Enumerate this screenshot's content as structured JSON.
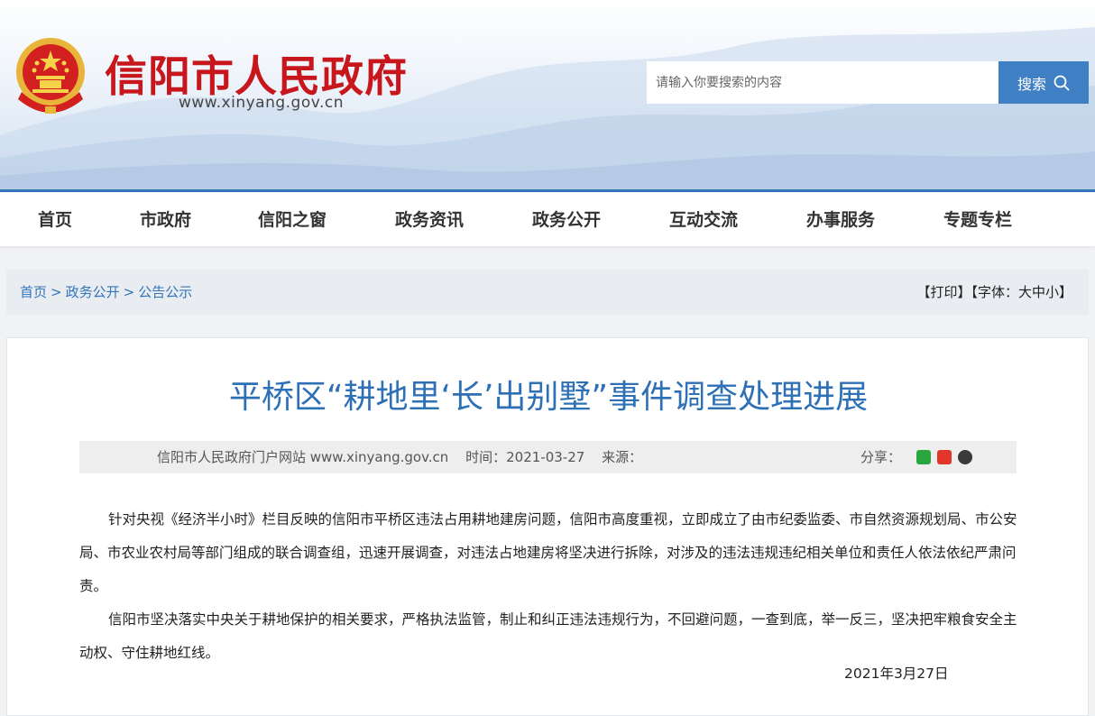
{
  "header": {
    "site_title": "信阳市人民政府",
    "site_url": "www.xinyang.gov.cn",
    "search_placeholder": "请输入你要搜索的内容",
    "search_label": "搜索",
    "emblem_icon": "national-emblem-icon"
  },
  "nav": {
    "items": [
      "首页",
      "市政府",
      "信阳之窗",
      "政务资讯",
      "政务公开",
      "互动交流",
      "办事服务",
      "专题专栏"
    ]
  },
  "breadcrumb": {
    "items": [
      "首页",
      "政务公开",
      "公告公示"
    ],
    "separator": ">",
    "print_label": "【打印】",
    "font_label": "【字体：大中小】"
  },
  "article": {
    "title": "平桥区“耕地里‘长’出别墅”事件调查处理进展",
    "meta_source": "信阳市人民政府门户网站 www.xinyang.gov.cn",
    "meta_time": "时间：2021-03-27",
    "meta_origin": "来源：",
    "share_label": "分享：",
    "share_icons": [
      "wechat-icon",
      "weibo-icon",
      "qq-icon"
    ],
    "paragraphs": [
      "针对央视《经济半小时》栏目反映的信阳市平桥区违法占用耕地建房问题，信阳市高度重视，立即成立了由市纪委监委、市自然资源规划局、市公安局、市农业农村局等部门组成的联合调查组，迅速开展调查，对违法占地建房将坚决进行拆除，对涉及的违法违规违纪相关单位和责任人依法依纪严肃问责。",
      "信阳市坚决落实中央关于耕地保护的相关要求，严格执法监管，制止和纠正违法违规行为，不回避问题，一查到底，举一反三，坚决把牢粮食安全主动权、守住耕地红线。"
    ],
    "date": "2021年3月27日"
  },
  "colors": {
    "brand_red": "#c8161d",
    "brand_blue": "#3275bb",
    "button_blue": "#3f80c4"
  }
}
